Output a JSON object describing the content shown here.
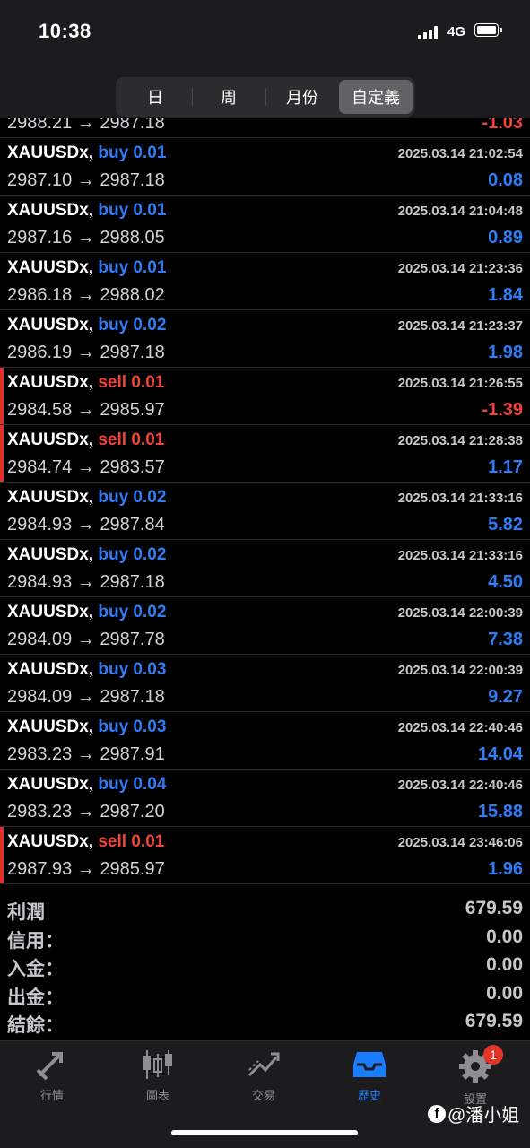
{
  "status_bar": {
    "time": "10:38",
    "network": "4G"
  },
  "segments": [
    "日",
    "周",
    "月份",
    "自定義"
  ],
  "active_segment": "自定義",
  "colors": {
    "buy": "#2f7cf6",
    "sell": "#f1443a",
    "accent": "#1a7cff"
  },
  "partial_row": {
    "prices": "2988.21 → 2987.18",
    "pnl": "-1.03"
  },
  "trades": [
    {
      "symbol": "XAUUSDx,",
      "side": "buy",
      "volume": "0.01",
      "datetime": "2025.03.14 21:02:54",
      "prices": "2987.10 → 2987.18",
      "pnl": "0.08"
    },
    {
      "symbol": "XAUUSDx,",
      "side": "buy",
      "volume": "0.01",
      "datetime": "2025.03.14 21:04:48",
      "prices": "2987.16 → 2988.05",
      "pnl": "0.89"
    },
    {
      "symbol": "XAUUSDx,",
      "side": "buy",
      "volume": "0.01",
      "datetime": "2025.03.14 21:23:36",
      "prices": "2986.18 → 2988.02",
      "pnl": "1.84"
    },
    {
      "symbol": "XAUUSDx,",
      "side": "buy",
      "volume": "0.02",
      "datetime": "2025.03.14 21:23:37",
      "prices": "2986.19 → 2987.18",
      "pnl": "1.98"
    },
    {
      "symbol": "XAUUSDx,",
      "side": "sell",
      "volume": "0.01",
      "datetime": "2025.03.14 21:26:55",
      "prices": "2984.58 → 2985.97",
      "pnl": "-1.39"
    },
    {
      "symbol": "XAUUSDx,",
      "side": "sell",
      "volume": "0.01",
      "datetime": "2025.03.14 21:28:38",
      "prices": "2984.74 → 2983.57",
      "pnl": "1.17"
    },
    {
      "symbol": "XAUUSDx,",
      "side": "buy",
      "volume": "0.02",
      "datetime": "2025.03.14 21:33:16",
      "prices": "2984.93 → 2987.84",
      "pnl": "5.82"
    },
    {
      "symbol": "XAUUSDx,",
      "side": "buy",
      "volume": "0.02",
      "datetime": "2025.03.14 21:33:16",
      "prices": "2984.93 → 2987.18",
      "pnl": "4.50"
    },
    {
      "symbol": "XAUUSDx,",
      "side": "buy",
      "volume": "0.02",
      "datetime": "2025.03.14 22:00:39",
      "prices": "2984.09 → 2987.78",
      "pnl": "7.38"
    },
    {
      "symbol": "XAUUSDx,",
      "side": "buy",
      "volume": "0.03",
      "datetime": "2025.03.14 22:00:39",
      "prices": "2984.09 → 2987.18",
      "pnl": "9.27"
    },
    {
      "symbol": "XAUUSDx,",
      "side": "buy",
      "volume": "0.03",
      "datetime": "2025.03.14 22:40:46",
      "prices": "2983.23 → 2987.91",
      "pnl": "14.04"
    },
    {
      "symbol": "XAUUSDx,",
      "side": "buy",
      "volume": "0.04",
      "datetime": "2025.03.14 22:40:46",
      "prices": "2983.23 → 2987.20",
      "pnl": "15.88"
    },
    {
      "symbol": "XAUUSDx,",
      "side": "sell",
      "volume": "0.01",
      "datetime": "2025.03.14 23:46:06",
      "prices": "2987.93 → 2985.97",
      "pnl": "1.96"
    }
  ],
  "summary": [
    {
      "label": "利潤",
      "value": "679.59"
    },
    {
      "label": "信用：",
      "value": "0.00"
    },
    {
      "label": "入金：",
      "value": "0.00"
    },
    {
      "label": "出金：",
      "value": "0.00"
    },
    {
      "label": "結餘：",
      "value": "679.59"
    }
  ],
  "tabs": [
    {
      "label": "行情",
      "icon": "arrows-icon"
    },
    {
      "label": "圖表",
      "icon": "candlestick-icon"
    },
    {
      "label": "交易",
      "icon": "trade-line-icon"
    },
    {
      "label": "歷史",
      "icon": "inbox-icon"
    },
    {
      "label": "設置",
      "icon": "gear-icon",
      "badge": "1"
    }
  ],
  "active_tab": "歷史",
  "watermark": "@潘小姐"
}
